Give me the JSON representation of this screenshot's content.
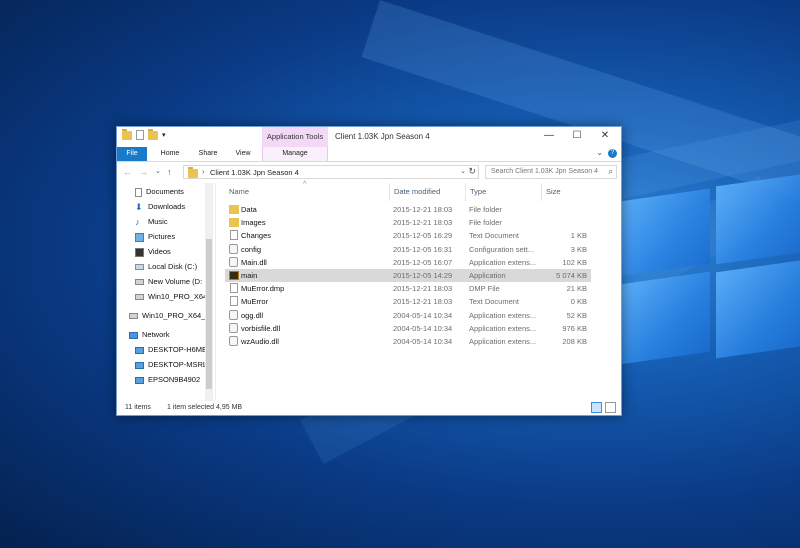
{
  "window": {
    "title": "Client 1.03K Jpn Season 4",
    "app_tools_label": "Application Tools",
    "controls": {
      "minimize": "—",
      "maximize": "☐",
      "close": "✕"
    }
  },
  "ribbon": {
    "tabs": [
      "File",
      "Home",
      "Share",
      "View",
      "Manage"
    ],
    "collapse_glyph": "⌄",
    "help_glyph": "?"
  },
  "address": {
    "back": "←",
    "forward": "→",
    "recent": "⌄",
    "up": "↑",
    "path": "Client 1.03K Jpn Season 4",
    "refresh": "↻",
    "search_placeholder": "Search Client 1.03K Jpn Season 4"
  },
  "nav": {
    "items": [
      {
        "label": "Documents",
        "icon": "documents-icon"
      },
      {
        "label": "Downloads",
        "icon": "downloads-icon"
      },
      {
        "label": "Music",
        "icon": "music-icon"
      },
      {
        "label": "Pictures",
        "icon": "pictures-icon"
      },
      {
        "label": "Videos",
        "icon": "videos-icon"
      },
      {
        "label": "Local Disk (C:)",
        "icon": "disk-icon"
      },
      {
        "label": "New Volume (D:",
        "icon": "drive-icon"
      },
      {
        "label": "Win10_PRO_X64",
        "icon": "drive-icon"
      },
      {
        "label": "Win10_PRO_X64_N",
        "icon": "usb-drive-icon"
      },
      {
        "label": "Network",
        "icon": "network-icon"
      },
      {
        "label": "DESKTOP-H6ME",
        "icon": "computer-icon"
      },
      {
        "label": "DESKTOP-MSRL",
        "icon": "computer-icon"
      },
      {
        "label": "EPSON9B4902",
        "icon": "computer-icon"
      }
    ]
  },
  "columns": {
    "name": "Name",
    "date": "Date modified",
    "type": "Type",
    "size": "Size"
  },
  "files": [
    {
      "name": "Data",
      "date": "2015-12-21 18:03",
      "type": "File folder",
      "size": "",
      "icon": "folder-icon"
    },
    {
      "name": "Images",
      "date": "2015-12-21 18:03",
      "type": "File folder",
      "size": "",
      "icon": "folder-icon"
    },
    {
      "name": "Changes",
      "date": "2015-12-05 16:29",
      "type": "Text Document",
      "size": "1 KB",
      "icon": "text-document-icon"
    },
    {
      "name": "config",
      "date": "2015-12-05 16:31",
      "type": "Configuration sett...",
      "size": "3 KB",
      "icon": "config-file-icon"
    },
    {
      "name": "Main.dll",
      "date": "2015-12-05 16:07",
      "type": "Application extens...",
      "size": "102 KB",
      "icon": "dll-icon"
    },
    {
      "name": "main",
      "date": "2015-12-05 14:29",
      "type": "Application",
      "size": "5 074 KB",
      "icon": "application-icon",
      "selected": true
    },
    {
      "name": "MuError.dmp",
      "date": "2015-12-21 18:03",
      "type": "DMP File",
      "size": "21 KB",
      "icon": "file-icon"
    },
    {
      "name": "MuError",
      "date": "2015-12-21 18:03",
      "type": "Text Document",
      "size": "0 KB",
      "icon": "text-document-icon"
    },
    {
      "name": "ogg.dll",
      "date": "2004-05-14 10:34",
      "type": "Application extens...",
      "size": "52 KB",
      "icon": "dll-icon"
    },
    {
      "name": "vorbisfile.dll",
      "date": "2004-05-14 10:34",
      "type": "Application extens...",
      "size": "976 KB",
      "icon": "dll-icon"
    },
    {
      "name": "wzAudio.dll",
      "date": "2004-05-14 10:34",
      "type": "Application extens...",
      "size": "208 KB",
      "icon": "dll-icon"
    }
  ],
  "status": {
    "count": "11 items",
    "selection": "1 item selected  4,95 MB"
  },
  "colors": {
    "accent": "#1979ca",
    "selection": "#d9d9d9",
    "folder": "#e9c452"
  }
}
